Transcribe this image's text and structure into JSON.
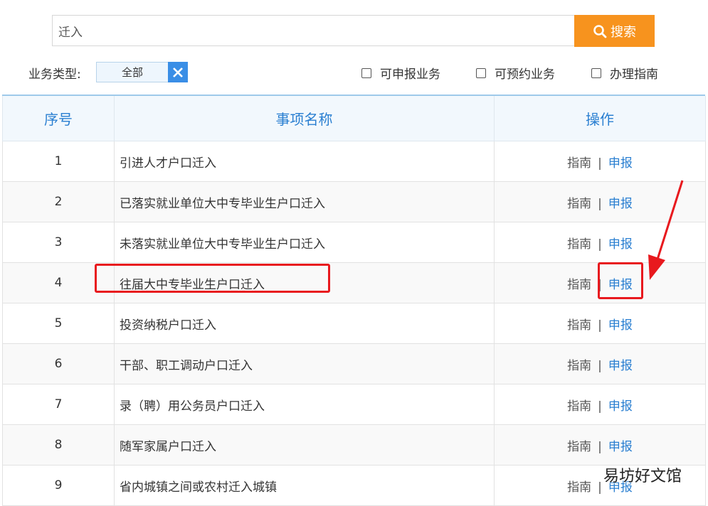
{
  "search": {
    "value": "迁入",
    "button_label": "搜索"
  },
  "filters": {
    "type_label": "业务类型:",
    "type_value": "全部",
    "checkboxes": [
      {
        "label": "可申报业务",
        "checked": false
      },
      {
        "label": "可预约业务",
        "checked": false
      },
      {
        "label": "办理指南",
        "checked": false
      }
    ]
  },
  "table": {
    "headers": [
      "序号",
      "事项名称",
      "操作"
    ],
    "guide_label": "指南",
    "separator": "|",
    "apply_label": "申报",
    "rows": [
      {
        "no": "1",
        "name": "引进人才户口迁入"
      },
      {
        "no": "2",
        "name": "已落实就业单位大中专毕业生户口迁入"
      },
      {
        "no": "3",
        "name": "未落实就业单位大中专毕业生户口迁入"
      },
      {
        "no": "4",
        "name": "往届大中专毕业生户口迁入"
      },
      {
        "no": "5",
        "name": "投资纳税户口迁入"
      },
      {
        "no": "6",
        "name": "干部、职工调动户口迁入"
      },
      {
        "no": "7",
        "name": "录（聘）用公务员户口迁入"
      },
      {
        "no": "8",
        "name": "随军家属户口迁入"
      },
      {
        "no": "9",
        "name": "省内城镇之间或农村迁入城镇"
      }
    ]
  },
  "watermark": "易坊好文馆",
  "colors": {
    "accent_orange": "#f7931e",
    "link_blue": "#2a7fd1",
    "highlight_red": "#e8191e"
  }
}
